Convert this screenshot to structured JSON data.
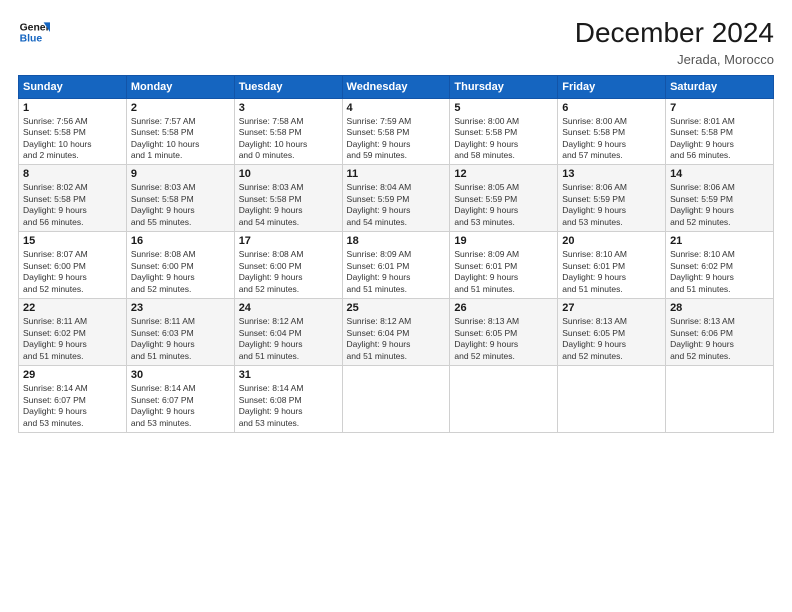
{
  "logo": {
    "line1": "General",
    "line2": "Blue"
  },
  "header": {
    "month": "December 2024",
    "location": "Jerada, Morocco"
  },
  "days_of_week": [
    "Sunday",
    "Monday",
    "Tuesday",
    "Wednesday",
    "Thursday",
    "Friday",
    "Saturday"
  ],
  "weeks": [
    [
      {
        "day": 1,
        "info": "Sunrise: 7:56 AM\nSunset: 5:58 PM\nDaylight: 10 hours\nand 2 minutes."
      },
      {
        "day": 2,
        "info": "Sunrise: 7:57 AM\nSunset: 5:58 PM\nDaylight: 10 hours\nand 1 minute."
      },
      {
        "day": 3,
        "info": "Sunrise: 7:58 AM\nSunset: 5:58 PM\nDaylight: 10 hours\nand 0 minutes."
      },
      {
        "day": 4,
        "info": "Sunrise: 7:59 AM\nSunset: 5:58 PM\nDaylight: 9 hours\nand 59 minutes."
      },
      {
        "day": 5,
        "info": "Sunrise: 8:00 AM\nSunset: 5:58 PM\nDaylight: 9 hours\nand 58 minutes."
      },
      {
        "day": 6,
        "info": "Sunrise: 8:00 AM\nSunset: 5:58 PM\nDaylight: 9 hours\nand 57 minutes."
      },
      {
        "day": 7,
        "info": "Sunrise: 8:01 AM\nSunset: 5:58 PM\nDaylight: 9 hours\nand 56 minutes."
      }
    ],
    [
      {
        "day": 8,
        "info": "Sunrise: 8:02 AM\nSunset: 5:58 PM\nDaylight: 9 hours\nand 56 minutes."
      },
      {
        "day": 9,
        "info": "Sunrise: 8:03 AM\nSunset: 5:58 PM\nDaylight: 9 hours\nand 55 minutes."
      },
      {
        "day": 10,
        "info": "Sunrise: 8:03 AM\nSunset: 5:58 PM\nDaylight: 9 hours\nand 54 minutes."
      },
      {
        "day": 11,
        "info": "Sunrise: 8:04 AM\nSunset: 5:59 PM\nDaylight: 9 hours\nand 54 minutes."
      },
      {
        "day": 12,
        "info": "Sunrise: 8:05 AM\nSunset: 5:59 PM\nDaylight: 9 hours\nand 53 minutes."
      },
      {
        "day": 13,
        "info": "Sunrise: 8:06 AM\nSunset: 5:59 PM\nDaylight: 9 hours\nand 53 minutes."
      },
      {
        "day": 14,
        "info": "Sunrise: 8:06 AM\nSunset: 5:59 PM\nDaylight: 9 hours\nand 52 minutes."
      }
    ],
    [
      {
        "day": 15,
        "info": "Sunrise: 8:07 AM\nSunset: 6:00 PM\nDaylight: 9 hours\nand 52 minutes."
      },
      {
        "day": 16,
        "info": "Sunrise: 8:08 AM\nSunset: 6:00 PM\nDaylight: 9 hours\nand 52 minutes."
      },
      {
        "day": 17,
        "info": "Sunrise: 8:08 AM\nSunset: 6:00 PM\nDaylight: 9 hours\nand 52 minutes."
      },
      {
        "day": 18,
        "info": "Sunrise: 8:09 AM\nSunset: 6:01 PM\nDaylight: 9 hours\nand 51 minutes."
      },
      {
        "day": 19,
        "info": "Sunrise: 8:09 AM\nSunset: 6:01 PM\nDaylight: 9 hours\nand 51 minutes."
      },
      {
        "day": 20,
        "info": "Sunrise: 8:10 AM\nSunset: 6:01 PM\nDaylight: 9 hours\nand 51 minutes."
      },
      {
        "day": 21,
        "info": "Sunrise: 8:10 AM\nSunset: 6:02 PM\nDaylight: 9 hours\nand 51 minutes."
      }
    ],
    [
      {
        "day": 22,
        "info": "Sunrise: 8:11 AM\nSunset: 6:02 PM\nDaylight: 9 hours\nand 51 minutes."
      },
      {
        "day": 23,
        "info": "Sunrise: 8:11 AM\nSunset: 6:03 PM\nDaylight: 9 hours\nand 51 minutes."
      },
      {
        "day": 24,
        "info": "Sunrise: 8:12 AM\nSunset: 6:04 PM\nDaylight: 9 hours\nand 51 minutes."
      },
      {
        "day": 25,
        "info": "Sunrise: 8:12 AM\nSunset: 6:04 PM\nDaylight: 9 hours\nand 51 minutes."
      },
      {
        "day": 26,
        "info": "Sunrise: 8:13 AM\nSunset: 6:05 PM\nDaylight: 9 hours\nand 52 minutes."
      },
      {
        "day": 27,
        "info": "Sunrise: 8:13 AM\nSunset: 6:05 PM\nDaylight: 9 hours\nand 52 minutes."
      },
      {
        "day": 28,
        "info": "Sunrise: 8:13 AM\nSunset: 6:06 PM\nDaylight: 9 hours\nand 52 minutes."
      }
    ],
    [
      {
        "day": 29,
        "info": "Sunrise: 8:14 AM\nSunset: 6:07 PM\nDaylight: 9 hours\nand 53 minutes."
      },
      {
        "day": 30,
        "info": "Sunrise: 8:14 AM\nSunset: 6:07 PM\nDaylight: 9 hours\nand 53 minutes."
      },
      {
        "day": 31,
        "info": "Sunrise: 8:14 AM\nSunset: 6:08 PM\nDaylight: 9 hours\nand 53 minutes."
      },
      null,
      null,
      null,
      null
    ]
  ]
}
